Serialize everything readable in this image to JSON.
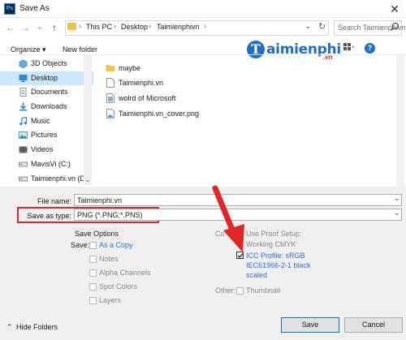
{
  "window": {
    "app_icon": "Ps",
    "title": "Save As",
    "close": "✕"
  },
  "nav": {
    "back": "←",
    "forward": "→",
    "dropdown": "⌄",
    "up": "↑",
    "breadcrumb": [
      "This PC",
      "Desktop",
      "Taimienphivn"
    ],
    "separator": "›",
    "addr_dropdown": "⌄",
    "refresh": "↻",
    "search_placeholder": "Search Taimienphivn"
  },
  "toolbar": {
    "organize_label": "Organize ▾",
    "new_folder_label": "New folder"
  },
  "watermark": {
    "badge": "T",
    "name": "aimienphi",
    "suffix": ".vn"
  },
  "sidebar": {
    "items": [
      {
        "label": "3D Objects",
        "icon": "3d-objects-icon",
        "selected": false
      },
      {
        "label": "Desktop",
        "icon": "desktop-icon",
        "selected": true
      },
      {
        "label": "Documents",
        "icon": "documents-icon",
        "selected": false
      },
      {
        "label": "Downloads",
        "icon": "downloads-icon",
        "selected": false
      },
      {
        "label": "Music",
        "icon": "music-icon",
        "selected": false
      },
      {
        "label": "Pictures",
        "icon": "pictures-icon",
        "selected": false
      },
      {
        "label": "Videos",
        "icon": "videos-icon",
        "selected": false
      },
      {
        "label": "MavisVi (C:)",
        "icon": "drive-icon",
        "selected": false
      },
      {
        "label": "Taimienphi.vn (D",
        "icon": "drive-icon",
        "selected": false
      }
    ],
    "scroll_down": "⌄"
  },
  "files": [
    {
      "name": "maybe",
      "type": "folder"
    },
    {
      "name": "Taimienphi.vn",
      "type": "document"
    },
    {
      "name": "wolrd of Microsoft",
      "type": "word-document"
    },
    {
      "name": "Taimienphi.vn_cover.png",
      "type": "image"
    }
  ],
  "form": {
    "file_name_label": "File name:",
    "file_name_value": "Taimienphi.vn",
    "save_as_type_label": "Save as type:",
    "save_as_type_value": "PNG (*.PNG;*.PNS)"
  },
  "save_options": {
    "heading": "Save Options",
    "save_label": "Save:",
    "as_a_copy": "As a Copy",
    "notes": "Notes",
    "alpha_channels": "Alpha Channels",
    "spot_colors": "Spot Colors",
    "layers": "Layers"
  },
  "color": {
    "label_partial": "Co",
    "use_proof_setup": "Use Proof Setup:",
    "working_cmyk": "Working CMYK",
    "icc_profile_line1": "ICC Profile:  sRGB",
    "icc_profile_line2": "IEC61966-2-1 black",
    "icc_profile_line3": "scaled",
    "other_label": "Other:",
    "thumbnail": "Thumbnail"
  },
  "footer": {
    "hide_folders": "Hide Folders",
    "save": "Save",
    "cancel": "Cancel"
  },
  "colors": {
    "accent_red": "#e0262b",
    "selected_bg": "#cce8ff",
    "link_blue": "#2b6fd6"
  }
}
